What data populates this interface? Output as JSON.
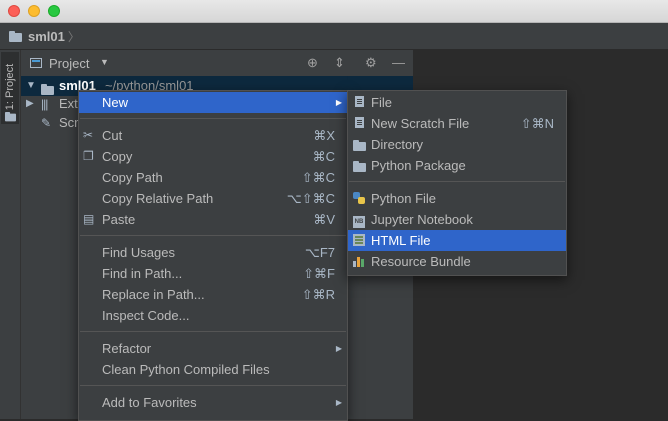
{
  "breadcrumb": {
    "project": "sml01"
  },
  "side_tab": {
    "label": "1: Project"
  },
  "panel": {
    "title": "Project",
    "tree": [
      {
        "name": "sml01",
        "path": "~/python/sml01"
      },
      {
        "name": "Ext"
      },
      {
        "name": "Scr"
      }
    ]
  },
  "context_menu": {
    "items": [
      {
        "label": "New",
        "shortcut": ""
      },
      {
        "label": "Cut",
        "shortcut": "⌘X"
      },
      {
        "label": "Copy",
        "shortcut": "⌘C"
      },
      {
        "label": "Copy Path",
        "shortcut": "⇧⌘C"
      },
      {
        "label": "Copy Relative Path",
        "shortcut": "⌥⇧⌘C"
      },
      {
        "label": "Paste",
        "shortcut": "⌘V"
      },
      {
        "label": "Find Usages",
        "shortcut": "⌥F7"
      },
      {
        "label": "Find in Path...",
        "shortcut": "⇧⌘F"
      },
      {
        "label": "Replace in Path...",
        "shortcut": "⇧⌘R"
      },
      {
        "label": "Inspect Code...",
        "shortcut": ""
      },
      {
        "label": "Refactor",
        "shortcut": ""
      },
      {
        "label": "Clean Python Compiled Files",
        "shortcut": ""
      },
      {
        "label": "Add to Favorites",
        "shortcut": ""
      }
    ]
  },
  "new_submenu": {
    "items": [
      {
        "label": "File",
        "shortcut": ""
      },
      {
        "label": "New Scratch File",
        "shortcut": "⇧⌘N"
      },
      {
        "label": "Directory",
        "shortcut": ""
      },
      {
        "label": "Python Package",
        "shortcut": ""
      },
      {
        "label": "Python File",
        "shortcut": ""
      },
      {
        "label": "Jupyter Notebook",
        "shortcut": ""
      },
      {
        "label": "HTML File",
        "shortcut": ""
      },
      {
        "label": "Resource Bundle",
        "shortcut": ""
      }
    ]
  },
  "colors": {
    "highlight": "#2f65ca",
    "panel_bg": "#3c3f41",
    "editor_bg": "#2b2b2b",
    "selected_row": "#0d293e"
  }
}
